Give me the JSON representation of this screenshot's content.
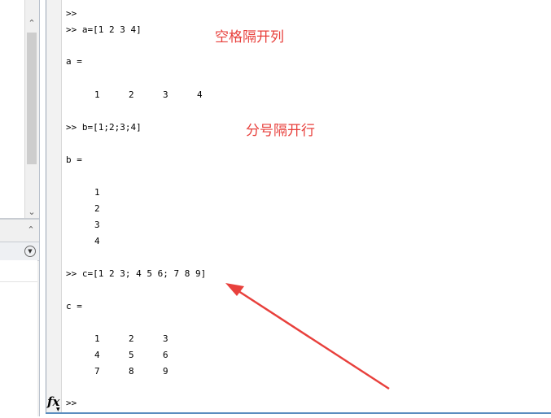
{
  "command_window": {
    "lines": [
      ">>",
      ">> a=[1 2 3 4]",
      "a =",
      ">> b=[1;2;3;4]",
      "b =",
      ">> c=[1 2 3; 4 5 6; 7 8 9]",
      "c ="
    ],
    "a_values": [
      "1",
      "2",
      "3",
      "4"
    ],
    "b_values": [
      "1",
      "2",
      "3",
      "4"
    ],
    "c_values": [
      [
        "1",
        "2",
        "3"
      ],
      [
        "4",
        "5",
        "6"
      ],
      [
        "7",
        "8",
        "9"
      ]
    ],
    "prompt": ">>",
    "fx_label": "fx"
  },
  "annotations": {
    "columns_note": "空格隔开列",
    "rows_note": "分号隔开行",
    "color": "#e8403c"
  },
  "icons": {
    "scroll_up": "chevron-up-icon",
    "scroll_down": "chevron-down-icon",
    "collapse": "collapse-icon"
  }
}
